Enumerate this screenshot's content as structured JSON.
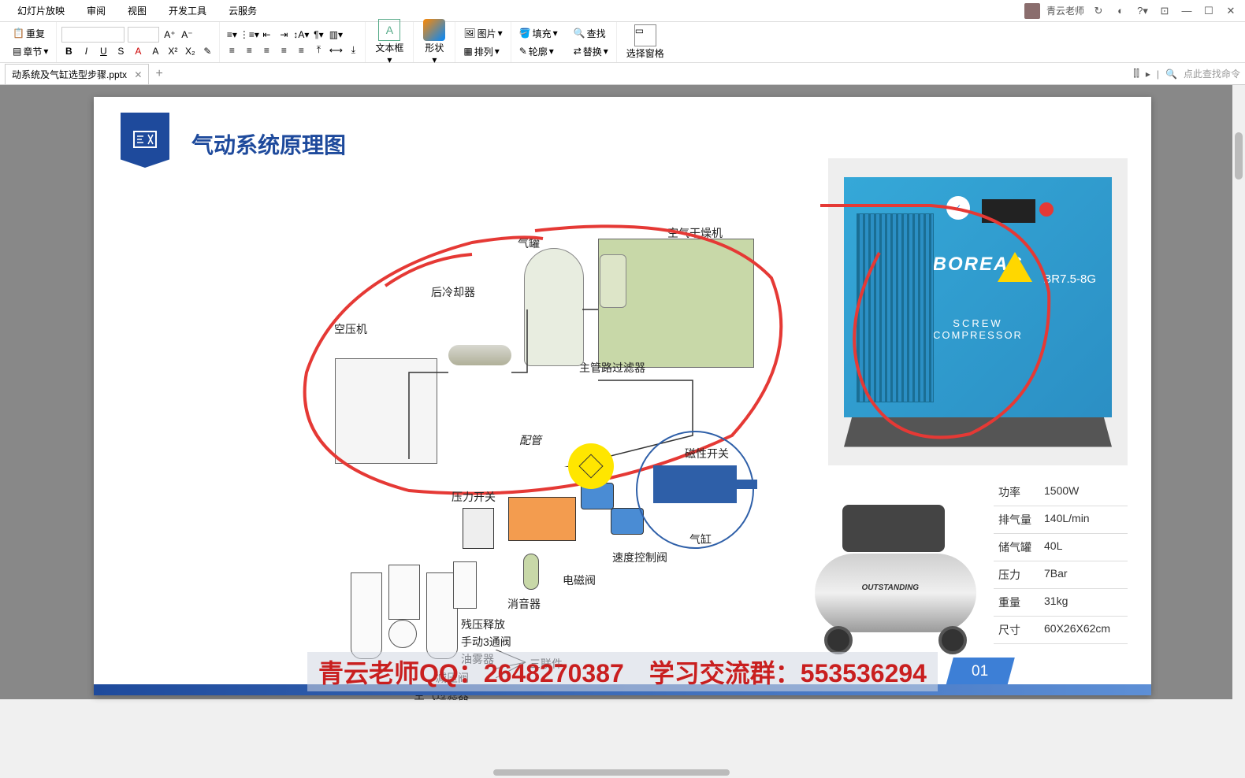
{
  "menubar": {
    "items": [
      "幻灯片放映",
      "审阅",
      "视图",
      "开发工具",
      "云服务"
    ],
    "user": "青云老师"
  },
  "ribbon": {
    "clipboard": {
      "copy": "重复",
      "chapter": "章节"
    },
    "font": {
      "family": "",
      "size": ""
    },
    "textbox": "文本框",
    "shape": "形状",
    "picture": "图片",
    "fill": "填充",
    "arrange": "排列",
    "outline": "轮廓",
    "find": "查找",
    "replace": "替换",
    "selectPane": "选择窗格"
  },
  "tabs": {
    "file": "动系统及气缸选型步骤.pptx",
    "searchPlaceholder": "点此查找命令"
  },
  "slide": {
    "title": "气动系统原理图",
    "diagram": {
      "air_compressor": "空压机",
      "aftercooler": "后冷却器",
      "air_tank": "气罐",
      "air_dryer": "空气干燥机",
      "main_filter": "主管路过滤器",
      "piping": "配管",
      "pressure_switch": "压力开关",
      "magnetic_switch": "磁性开关",
      "cylinder": "气缸",
      "speed_valve": "速度控制阀",
      "solenoid": "电磁阀",
      "silencer": "消音器",
      "residual_release": "残压释放",
      "manual_valve": "手动3通阀",
      "lubricator": "油雾器",
      "regulator": "减压阀",
      "air_filter": "空气过滤器",
      "frl": "三联件"
    },
    "compressor_image": {
      "brand": "BOREAS",
      "model": "BR7.5-8G",
      "text1": "SCREW",
      "text2": "COMPRESSOR"
    },
    "tank_image": {
      "brand": "OUTSTANDING"
    },
    "specs": [
      {
        "label": "功率",
        "value": "1500W"
      },
      {
        "label": "排气量",
        "value": "140L/min"
      },
      {
        "label": "储气罐",
        "value": "40L"
      },
      {
        "label": "压力",
        "value": "7Bar"
      },
      {
        "label": "重量",
        "value": "31kg"
      },
      {
        "label": "尺寸",
        "value": "60X26X62cm"
      }
    ],
    "page": "01",
    "footer": "青云老师QQ：2648270387　学习交流群：553536294"
  }
}
